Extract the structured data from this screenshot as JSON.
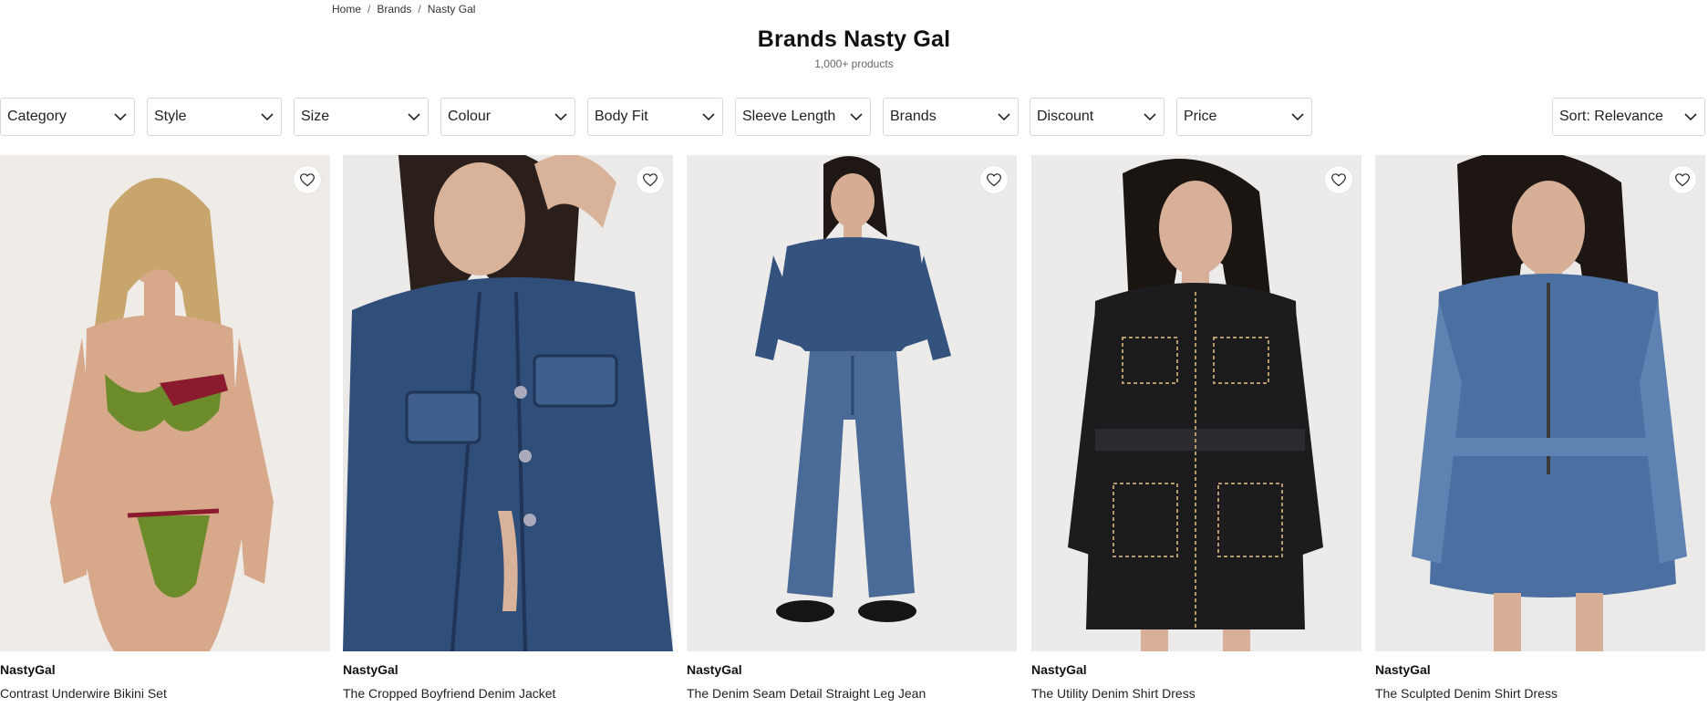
{
  "breadcrumb": {
    "home": "Home",
    "brands": "Brands",
    "current": "Nasty Gal",
    "separator": "/"
  },
  "page": {
    "title": "Brands Nasty Gal",
    "count": "1,000+ products"
  },
  "filters": [
    {
      "label": "Category"
    },
    {
      "label": "Style"
    },
    {
      "label": "Size"
    },
    {
      "label": "Colour"
    },
    {
      "label": "Body Fit"
    },
    {
      "label": "Sleeve Length"
    },
    {
      "label": "Brands"
    },
    {
      "label": "Discount"
    },
    {
      "label": "Price"
    }
  ],
  "sort": {
    "label": "Sort: Relevance"
  },
  "products": [
    {
      "brand": "NastyGal",
      "name": "Contrast Underwire Bikini Set",
      "bg": "#efebe7",
      "main": "#6c8b2a",
      "accent": "#8b1a2e",
      "skin": "#d7a88a",
      "hair": "#c8a56c"
    },
    {
      "brand": "NastyGal",
      "name": "The Cropped Boyfriend Denim Jacket",
      "bg": "#ebeae8",
      "main": "#2f4e7a",
      "accent": "#3e5f8e",
      "skin": "#d9b29a",
      "hair": "#2a1f1a"
    },
    {
      "brand": "NastyGal",
      "name": "The Denim Seam Detail Straight Leg Jean",
      "bg": "#ecebe9",
      "main": "#34527e",
      "accent": "#4a6a98",
      "skin": "#d6ad93",
      "hair": "#1e1713"
    },
    {
      "brand": "NastyGal",
      "name": "The Utility Denim Shirt Dress",
      "bg": "#ecebea",
      "main": "#1c1c1e",
      "accent": "#2c2c30",
      "skin": "#d8b099",
      "hair": "#1b1512"
    },
    {
      "brand": "NastyGal",
      "name": "The Sculpted Denim Shirt Dress",
      "bg": "#ebeae9",
      "main": "#4a6fa0",
      "accent": "#5e82b2",
      "skin": "#d7ae96",
      "hair": "#1d1612"
    }
  ],
  "colors": {
    "border": "#d9d9d9",
    "text": "#111111",
    "muted": "#666666"
  }
}
